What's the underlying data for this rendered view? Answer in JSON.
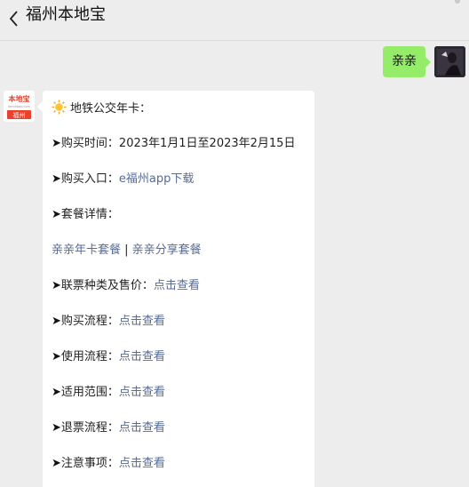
{
  "header": {
    "title": "福州本地宝"
  },
  "me": {
    "message": "亲亲"
  },
  "bot": {
    "logo_text": "本地宝",
    "logo_sub": "bendibao.com",
    "logo_city": "福州",
    "intro": "地铁公交年卡：",
    "arrow": "➤",
    "lines": [
      {
        "label": "购买时间：",
        "value": "2023年1月1日至2023年2月15日"
      },
      {
        "label": "购买入口：",
        "link": "e福州app下载"
      },
      {
        "label": "套餐详情："
      },
      {
        "link_a": "亲亲年卡套餐",
        "separator": " | ",
        "link_b": "亲亲分享套餐"
      },
      {
        "label": "联票种类及售价：",
        "link": "点击查看"
      },
      {
        "label": "购买流程：",
        "link": "点击查看"
      },
      {
        "label": "使用流程：",
        "link": "点击查看"
      },
      {
        "label": "适用范围：",
        "link": "点击查看"
      },
      {
        "label": "退票流程：",
        "link": "点击查看"
      },
      {
        "label": "注意事项：",
        "link": "点击查看"
      }
    ]
  }
}
